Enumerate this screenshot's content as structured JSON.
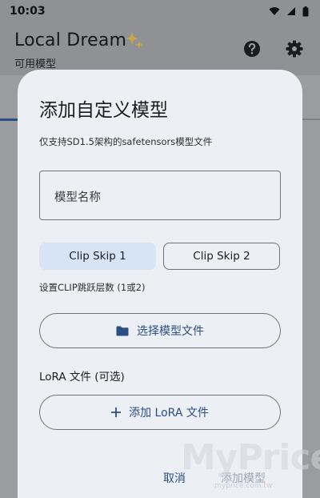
{
  "status_bar": {
    "time": "10:03",
    "icons": [
      "wifi-icon",
      "signal-icon",
      "battery-icon"
    ]
  },
  "app_bar": {
    "title": "Local Dream",
    "subtitle": "可用模型",
    "icons": [
      "sparkle-icon",
      "help-icon",
      "settings-icon"
    ]
  },
  "dialog": {
    "title": "添加自定义模型",
    "description": "仅支持SD1.5架构的safetensors模型文件",
    "name_field": {
      "placeholder": "模型名称",
      "value": ""
    },
    "clip_skip": {
      "options": [
        "Clip Skip 1",
        "Clip Skip 2"
      ],
      "selected": "Clip Skip 1",
      "hint": "设置CLIP跳跃层数 (1或2)"
    },
    "select_file_button": "选择模型文件",
    "lora_label": "LoRA 文件 (可选)",
    "add_lora_button": "添加 LoRA 文件",
    "actions": {
      "cancel": "取消",
      "confirm": "添加模型"
    }
  },
  "watermark": {
    "brand": "MyPrice",
    "url": "myprice.com.tw"
  },
  "colors": {
    "accent": "#2a4f86",
    "dialog_bg": "#eceff3",
    "scrim": "#9a9c9f",
    "selected_segment": "#d6e4f5"
  }
}
